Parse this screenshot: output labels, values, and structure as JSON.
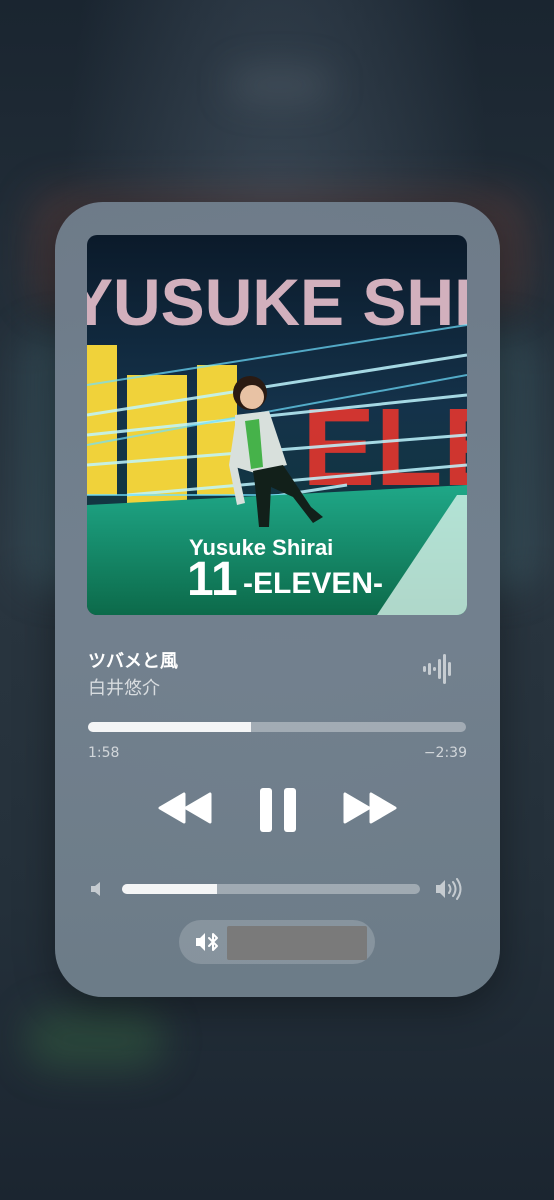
{
  "now_playing": {
    "title": "ツバメと風",
    "artist": "白井悠介",
    "elapsed": "1:58",
    "remaining": "−2:39",
    "progress": 0.43,
    "volume": 0.32,
    "album_art": {
      "artist_text": "YUSUKE SHIRAI",
      "cover_artist": "Yusuke Shirai",
      "cover_number": "11",
      "cover_title": "-ELEVEN-",
      "backdrop_text": "ELEVEN"
    }
  },
  "controls": {
    "rewind_icon": "rewind-icon",
    "pause_icon": "pause-icon",
    "forward_icon": "fast-forward-icon",
    "volume_low_icon": "speaker-low-icon",
    "volume_high_icon": "speaker-high-icon",
    "waveform_icon": "waveform-icon",
    "route_icon": "bluetooth-speaker-icon"
  },
  "colors": {
    "card": "#76848f",
    "track": "#ffffff59",
    "fill": "#ffffffe0"
  }
}
